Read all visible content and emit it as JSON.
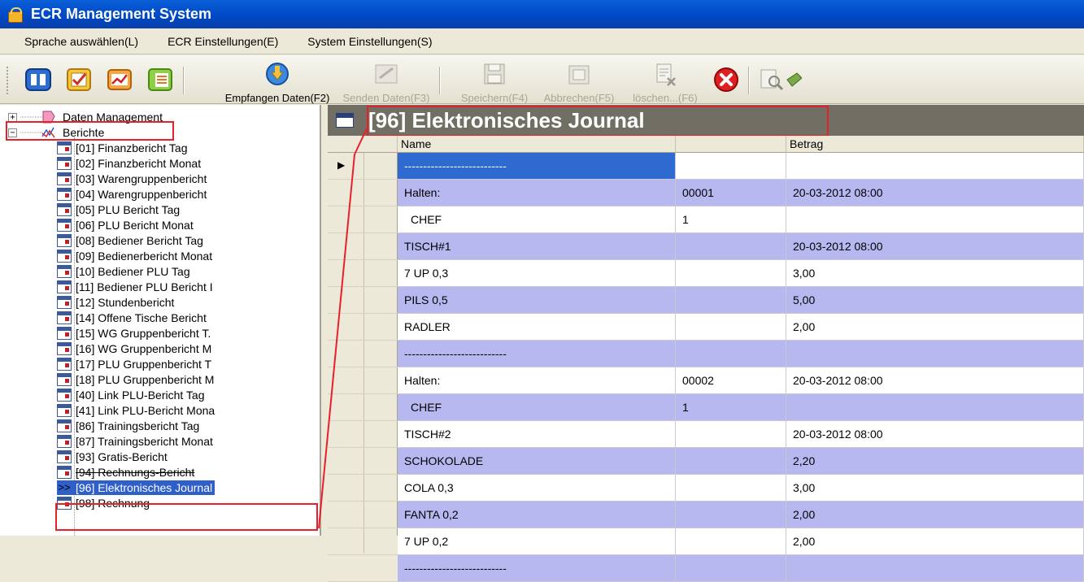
{
  "window": {
    "title": "ECR Management System"
  },
  "menu": [
    "Sprache auswählen(L)",
    "ECR Einstellungen(E)",
    "System Einstellungen(S)"
  ],
  "toolbar": {
    "empfangen": "Empfangen Daten(F2)",
    "senden": "Senden Daten(F3)",
    "speichern": "Speichern(F4)",
    "abbrechen": "Abbrechen(F5)",
    "loeschen": "löschen...(F6)"
  },
  "sidebar": {
    "daten_management": "Daten Management",
    "berichte": "Berichte",
    "reports": [
      "[01] Finanzbericht Tag",
      "[02] Finanzbericht Monat",
      "[03] Warengruppenbericht",
      "[04] Warengruppenbericht",
      "[05] PLU Bericht Tag",
      "[06] PLU Bericht Monat",
      "[08] Bediener Bericht Tag",
      "[09] Bedienerbericht Monat",
      "[10] Bediener PLU Tag",
      "[11] Bediener PLU Bericht I",
      "[12] Stundenbericht",
      "[14] Offene Tische Bericht",
      "[15] WG Gruppenbericht T.",
      "[16] WG Gruppenbericht M",
      "[17] PLU Gruppenbericht T",
      "[18] PLU Gruppenbericht M",
      "[40] Link PLU-Bericht Tag",
      "[41] Link PLU-Bericht Mona",
      "[86] Trainingsbericht Tag",
      "[87] Trainingsbericht Monat",
      "[93] Gratis-Bericht",
      "[94] Rechnungs-Bericht",
      "[96] Elektronisches Journal",
      "[98] Rechnung"
    ],
    "selected_marker": ">>"
  },
  "main": {
    "title": "[96] Elektronisches Journal",
    "columns": [
      "Name",
      "",
      "Betrag"
    ],
    "current_row_marker": "▶",
    "rows": [
      [
        "---------------------------",
        "",
        ""
      ],
      [
        "Halten:",
        "00001",
        "20-03-2012 08:00"
      ],
      [
        " CHEF",
        "1",
        ""
      ],
      [
        "TISCH#1",
        "",
        "20-03-2012 08:00"
      ],
      [
        "7 UP 0,3",
        "",
        "3,00"
      ],
      [
        "PILS 0,5",
        "",
        "5,00"
      ],
      [
        "RADLER",
        "",
        "2,00"
      ],
      [
        "---------------------------",
        "",
        ""
      ],
      [
        "Halten:",
        "00002",
        "20-03-2012 08:00"
      ],
      [
        " CHEF",
        "1",
        ""
      ],
      [
        "TISCH#2",
        "",
        "20-03-2012 08:00"
      ],
      [
        "SCHOKOLADE",
        "",
        "2,20"
      ],
      [
        "COLA 0,3",
        "",
        "3,00"
      ],
      [
        "FANTA 0,2",
        "",
        "2,00"
      ],
      [
        "7 UP 0,2",
        "",
        "2,00"
      ],
      [
        "---------------------------",
        "",
        ""
      ]
    ]
  }
}
